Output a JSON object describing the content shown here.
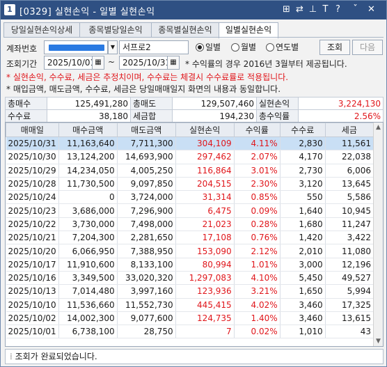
{
  "title": {
    "number": "1",
    "text": "[0329] 실현손익 - 일별 실현손익",
    "controls": [
      "⊞",
      "⇄",
      "⊥",
      "T",
      "?",
      "ˇ",
      "✕"
    ]
  },
  "tabs": [
    {
      "label": "당일실현손익상세",
      "active": false
    },
    {
      "label": "종목별당일손익",
      "active": false
    },
    {
      "label": "종목별실현손익",
      "active": false
    },
    {
      "label": "일별실현손익",
      "active": true
    }
  ],
  "form": {
    "account_label": "계좌번호",
    "account_name": "서프로2",
    "period_label": "조회기간",
    "start_date": "2025/10/01",
    "end_date": "2025/10/31",
    "radios": [
      {
        "label": "일별",
        "checked": true
      },
      {
        "label": "월별",
        "checked": false
      },
      {
        "label": "연도별",
        "checked": false
      }
    ],
    "query_button": "조회",
    "next_button": "다음",
    "rate_note": "* 수익률의 경우 2016년 3월부터 제공됩니다."
  },
  "notes": {
    "red": "* 실현손익, 수수료, 세금은 추정치이며, 수수료는 체결시 수수료률로 적용됩니다.",
    "black": "* 매입금액, 매도금액, 수수료, 세금은 당일매매일지 화면의 내용과 동일합니다."
  },
  "summary": {
    "buy_total_label": "총매수",
    "buy_total": "125,491,280",
    "sell_total_label": "총매도",
    "sell_total": "129,507,460",
    "realized_label": "실현손익",
    "realized": "3,224,130",
    "fee_label": "수수료",
    "fee": "38,180",
    "tax_label": "세금합",
    "tax": "194,230",
    "rate_label": "총수익률",
    "rate": "2.56%"
  },
  "columns": [
    "매매일",
    "매수금액",
    "매도금액",
    "실현손익",
    "수익률",
    "수수료",
    "세금"
  ],
  "rows": [
    [
      "2025/10/31",
      "11,163,640",
      "7,711,300",
      "304,109",
      "4.11%",
      "2,830",
      "11,561"
    ],
    [
      "2025/10/30",
      "13,124,200",
      "14,693,900",
      "297,462",
      "2.07%",
      "4,170",
      "22,038"
    ],
    [
      "2025/10/29",
      "14,234,050",
      "4,005,250",
      "116,864",
      "3.01%",
      "2,730",
      "6,006"
    ],
    [
      "2025/10/28",
      "11,730,500",
      "9,097,850",
      "204,515",
      "2.30%",
      "3,120",
      "13,645"
    ],
    [
      "2025/10/24",
      "0",
      "3,724,000",
      "31,314",
      "0.85%",
      "550",
      "5,586"
    ],
    [
      "2025/10/23",
      "3,686,000",
      "7,296,900",
      "6,475",
      "0.09%",
      "1,640",
      "10,945"
    ],
    [
      "2025/10/22",
      "3,730,000",
      "7,498,000",
      "21,023",
      "0.28%",
      "1,680",
      "11,247"
    ],
    [
      "2025/10/21",
      "7,204,300",
      "2,281,650",
      "17,108",
      "0.76%",
      "1,420",
      "3,422"
    ],
    [
      "2025/10/20",
      "6,066,950",
      "7,388,950",
      "153,090",
      "2.12%",
      "2,010",
      "11,080"
    ],
    [
      "2025/10/17",
      "11,910,600",
      "8,133,100",
      "80,994",
      "1.01%",
      "3,000",
      "12,196"
    ],
    [
      "2025/10/16",
      "3,349,500",
      "33,020,320",
      "1,297,083",
      "4.10%",
      "5,450",
      "49,527"
    ],
    [
      "2025/10/13",
      "7,014,480",
      "3,997,160",
      "123,936",
      "3.21%",
      "1,650",
      "5,994"
    ],
    [
      "2025/10/10",
      "11,536,660",
      "11,552,730",
      "445,415",
      "4.02%",
      "3,460",
      "17,325"
    ],
    [
      "2025/10/02",
      "14,002,300",
      "9,077,600",
      "124,735",
      "1.40%",
      "3,460",
      "13,615"
    ],
    [
      "2025/10/01",
      "6,738,100",
      "28,750",
      "7",
      "0.02%",
      "1,010",
      "43"
    ]
  ],
  "status": "조회가 완료되었습니다.",
  "colors": {
    "title_bg": "#2f5083",
    "positive": "#e0161b",
    "selected_row": "#c9dff5"
  }
}
